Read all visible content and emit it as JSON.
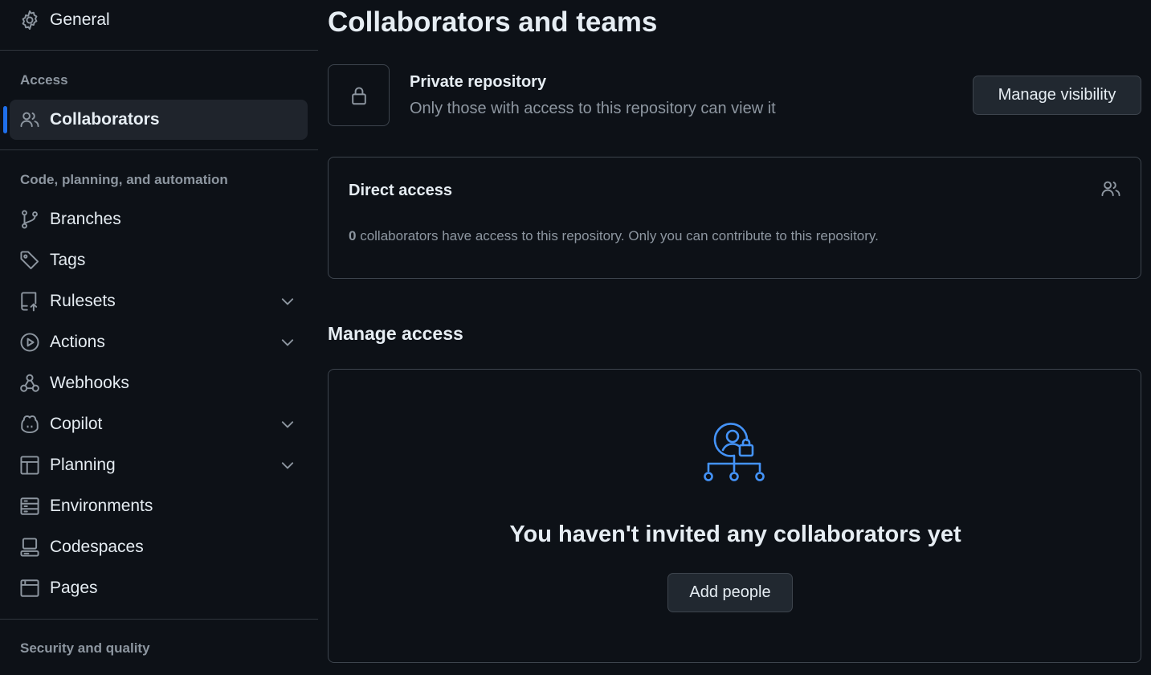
{
  "sidebar": {
    "general": {
      "label": "General",
      "icon": "gear-icon"
    },
    "access_heading": "Access",
    "collaborators": {
      "label": "Collaborators",
      "icon": "people-icon"
    },
    "code_heading": "Code, planning, and automation",
    "items": [
      {
        "label": "Branches",
        "icon": "git-branch-icon",
        "expandable": false
      },
      {
        "label": "Tags",
        "icon": "tag-icon",
        "expandable": false
      },
      {
        "label": "Rulesets",
        "icon": "repo-push-icon",
        "expandable": true
      },
      {
        "label": "Actions",
        "icon": "play-icon",
        "expandable": true
      },
      {
        "label": "Webhooks",
        "icon": "webhook-icon",
        "expandable": false
      },
      {
        "label": "Copilot",
        "icon": "copilot-icon",
        "expandable": true
      },
      {
        "label": "Planning",
        "icon": "table-icon",
        "expandable": true
      },
      {
        "label": "Environments",
        "icon": "server-icon",
        "expandable": false
      },
      {
        "label": "Codespaces",
        "icon": "codespaces-icon",
        "expandable": false
      },
      {
        "label": "Pages",
        "icon": "browser-icon",
        "expandable": false
      }
    ],
    "security_heading": "Security and quality"
  },
  "main": {
    "title": "Collaborators and teams",
    "visibility": {
      "title": "Private repository",
      "description": "Only those with access to this repository can view it",
      "button_label": "Manage visibility"
    },
    "direct_access": {
      "title": "Direct access",
      "count": "0",
      "description": " collaborators have access to this repository. Only you can contribute to this repository."
    },
    "manage_access": {
      "title": "Manage access",
      "empty_title": "You haven't invited any collaborators yet",
      "button_label": "Add people"
    }
  },
  "colors": {
    "background": "#0d1117",
    "active_indicator": "#1f6feb",
    "accent_icon": "#4493f8",
    "muted_text": "#8d96a0",
    "border": "#3d444d"
  }
}
